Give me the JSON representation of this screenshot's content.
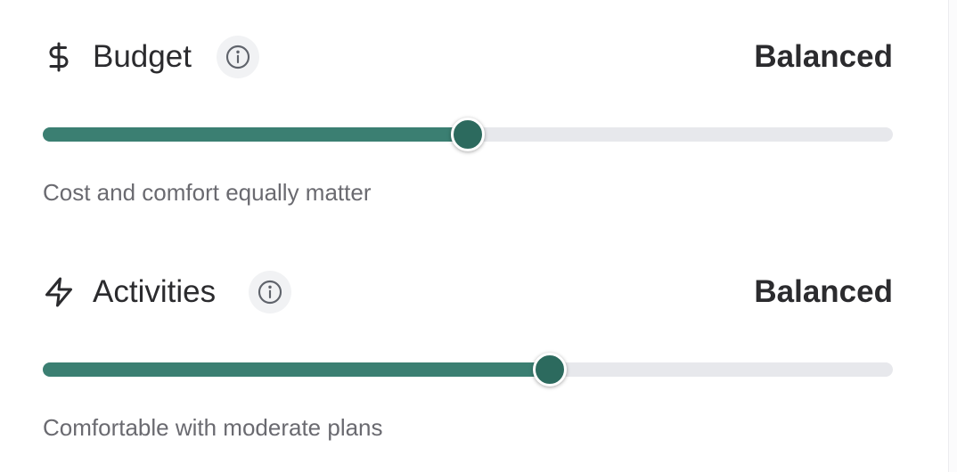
{
  "preferences": [
    {
      "icon": "dollar-sign-icon",
      "title": "Budget",
      "value_label": "Balanced",
      "description": "Cost and comfort equally matter",
      "level_fraction": 0.5
    },
    {
      "icon": "lightning-bolt-icon",
      "title": "Activities",
      "value_label": "Balanced",
      "description": "Comfortable with moderate plans",
      "level_fraction": 0.596
    }
  ],
  "colors": {
    "accent": "#3b7f72",
    "thumb": "#2c6a5e",
    "track": "#e7e8ec",
    "text": "#2b2b2e",
    "muted_text": "#6a6a70",
    "info_bg": "#f1f2f4"
  }
}
